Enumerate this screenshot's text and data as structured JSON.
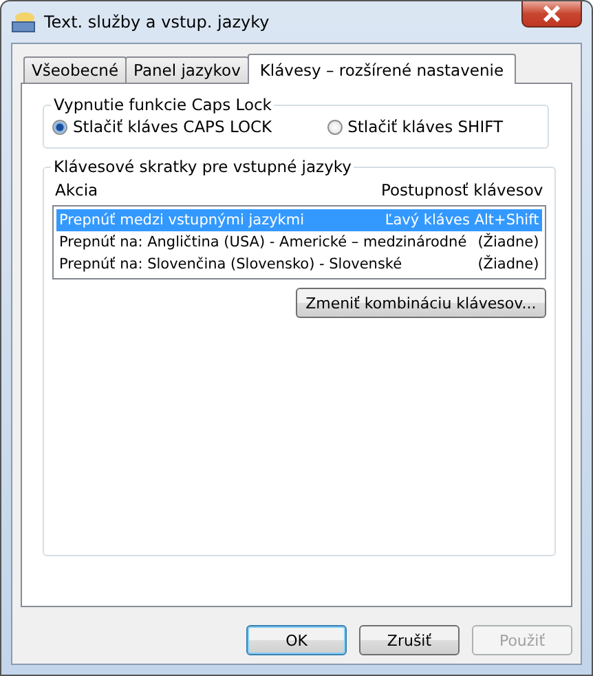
{
  "window": {
    "title": "Text. služby a vstup. jazyky"
  },
  "tabs": [
    {
      "label": "Všeobecné",
      "selected": false
    },
    {
      "label": "Panel jazykov",
      "selected": false
    },
    {
      "label": "Klávesy – rozšírené nastavenie",
      "selected": true
    }
  ],
  "caps_lock": {
    "title": "Vypnutie funkcie Caps Lock",
    "options": [
      {
        "label": "Stlačiť kláves CAPS LOCK",
        "selected": true
      },
      {
        "label": "Stlačiť kláves SHIFT",
        "selected": false
      }
    ]
  },
  "shortcuts": {
    "title": "Klávesové skratky pre vstupné jazyky",
    "columns": [
      "Akcia",
      "Postupnosť klávesov"
    ],
    "rows": [
      {
        "action": "Prepnúť medzi vstupnými jazykmi",
        "keys": "Ľavý kláves Alt+Shift",
        "selected": true
      },
      {
        "action": "Prepnúť na: Angličtina (USA) - Americké – medzinárodné",
        "keys": "(Žiadne)",
        "selected": false
      },
      {
        "action": "Prepnúť na: Slovenčina (Slovensko) - Slovenské",
        "keys": "(Žiadne)",
        "selected": false
      }
    ],
    "button": "Zmeniť kombináciu klávesov..."
  },
  "buttons": [
    {
      "label": "OK",
      "default": true,
      "disabled": false
    },
    {
      "label": "Zrušiť",
      "default": false,
      "disabled": false
    },
    {
      "label": "Použiť",
      "default": false,
      "disabled": true
    }
  ]
}
